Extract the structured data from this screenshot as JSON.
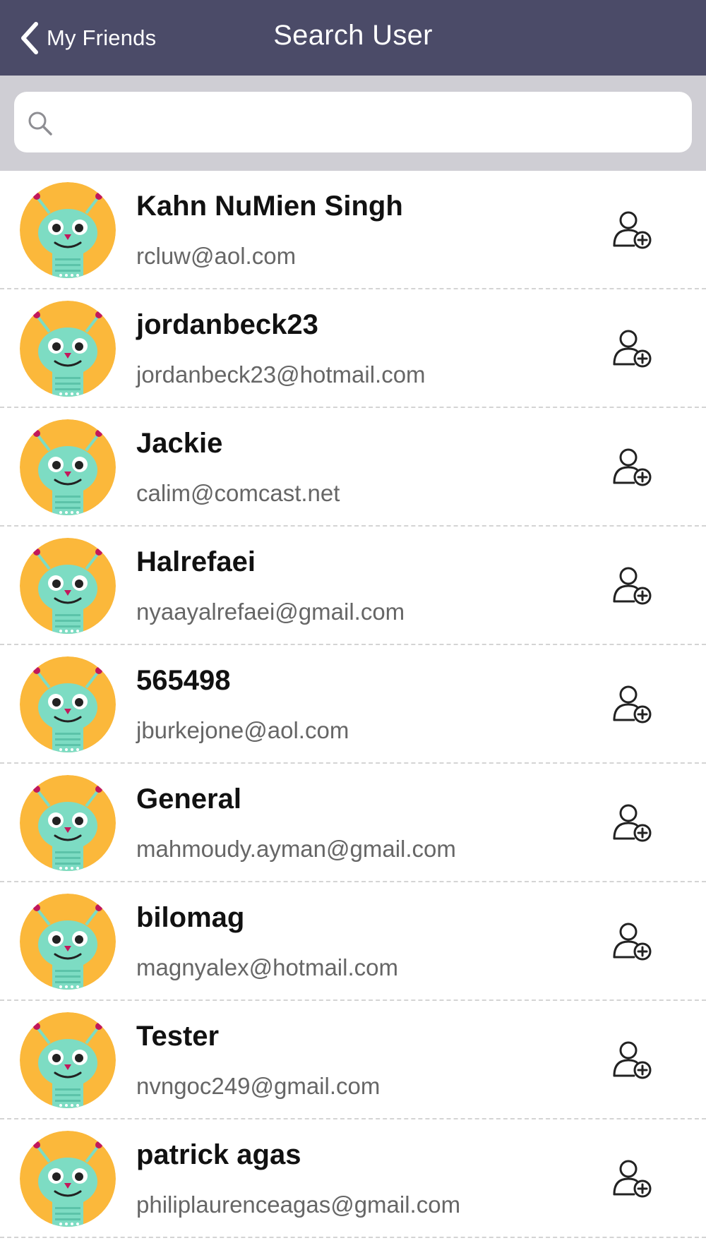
{
  "nav": {
    "back_label": "My Friends",
    "title": "Search User",
    "background_color": "#4b4b68",
    "icons": {
      "back": "chevron-left-icon"
    }
  },
  "search": {
    "value": "",
    "placeholder": "",
    "icon": "search-icon"
  },
  "users": [
    {
      "name": "Kahn NuMien Singh",
      "email": "rcluw@aol.com"
    },
    {
      "name": "jordanbeck23",
      "email": "jordanbeck23@hotmail.com"
    },
    {
      "name": "Jackie",
      "email": "calim@comcast.net"
    },
    {
      "name": "Halrefaei",
      "email": "nyaayalrefaei@gmail.com"
    },
    {
      "name": "565498",
      "email": "jburkejone@aol.com"
    },
    {
      "name": "General",
      "email": "mahmoudy.ayman@gmail.com"
    },
    {
      "name": "bilomag",
      "email": "magnyalex@hotmail.com"
    },
    {
      "name": "Tester",
      "email": "nvngoc249@gmail.com"
    },
    {
      "name": "patrick agas",
      "email": "philiplaurenceagas@gmail.com"
    }
  ],
  "row_icons": {
    "avatar": "robot-avatar-icon",
    "action": "add-user-icon"
  },
  "colors": {
    "avatar_background": "#fbb83b",
    "robot_body": "#7ddcc3",
    "divider": "#d4d4d4",
    "search_band": "#cfced4"
  }
}
